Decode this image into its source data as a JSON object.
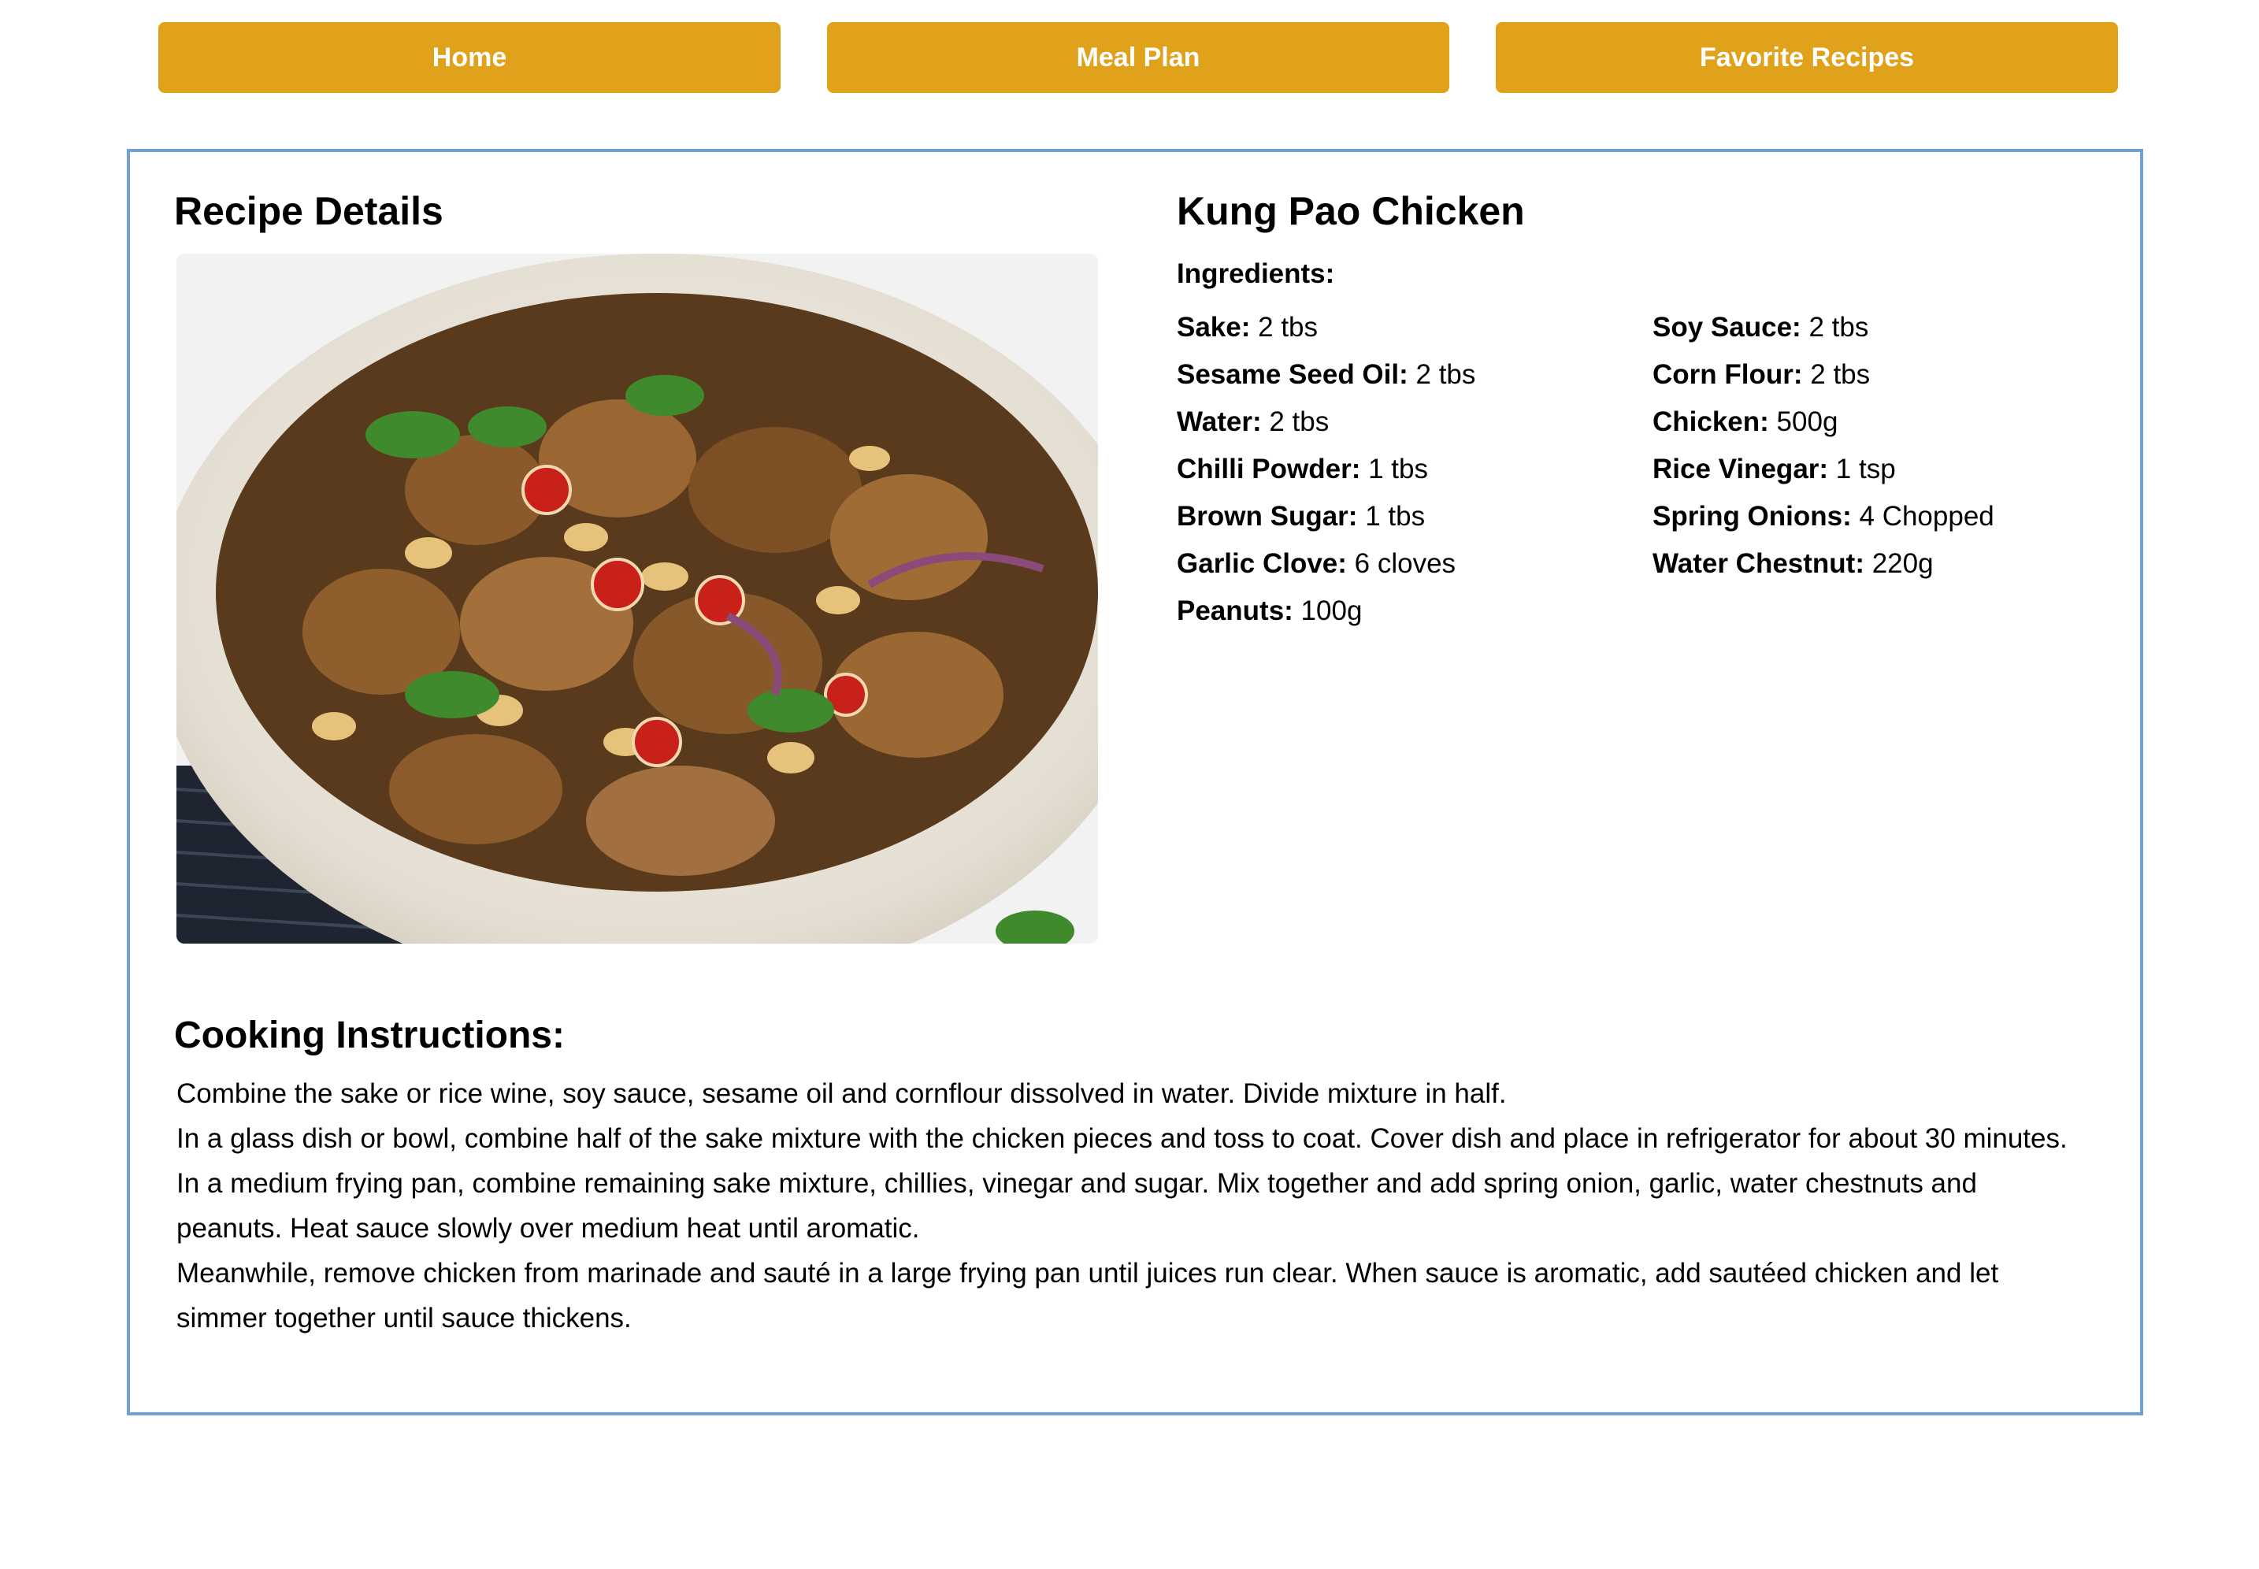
{
  "nav": {
    "buttons": [
      {
        "label": "Home"
      },
      {
        "label": "Meal Plan"
      },
      {
        "label": "Favorite Recipes"
      }
    ]
  },
  "recipe": {
    "section_title": "Recipe Details",
    "name": "Kung Pao Chicken",
    "ingredients_label": "Ingredients:",
    "ingredients_col1": [
      {
        "name": "Sake:",
        "amount": "2 tbs"
      },
      {
        "name": "Sesame Seed Oil:",
        "amount": "2 tbs"
      },
      {
        "name": "Water:",
        "amount": "2 tbs"
      },
      {
        "name": "Chilli Powder:",
        "amount": "1 tbs"
      },
      {
        "name": "Brown Sugar:",
        "amount": "1 tbs"
      },
      {
        "name": "Garlic Clove:",
        "amount": "6 cloves"
      },
      {
        "name": "Peanuts:",
        "amount": "100g"
      }
    ],
    "ingredients_col2": [
      {
        "name": "Soy Sauce:",
        "amount": "2 tbs"
      },
      {
        "name": "Corn Flour:",
        "amount": "2 tbs"
      },
      {
        "name": "Chicken:",
        "amount": "500g"
      },
      {
        "name": "Rice Vinegar:",
        "amount": "1 tsp"
      },
      {
        "name": "Spring Onions:",
        "amount": "4 Chopped"
      },
      {
        "name": "Water Chestnut:",
        "amount": "220g"
      }
    ],
    "instructions_title": "Cooking Instructions:",
    "instructions": [
      "Combine the sake or rice wine, soy sauce, sesame oil and cornflour dissolved in water. Divide mixture in half.",
      "In a glass dish or bowl, combine half of the sake mixture with the chicken pieces and toss to coat. Cover dish and place in refrigerator for about 30 minutes.",
      "In a medium frying pan, combine remaining sake mixture, chillies, vinegar and sugar. Mix together and add spring onion, garlic, water chestnuts and peanuts. Heat sauce slowly over medium heat until aromatic.",
      "Meanwhile, remove chicken from marinade and sauté in a large frying pan until juices run clear. When sauce is aromatic, add sautéed chicken and let simmer together until sauce thickens."
    ]
  },
  "colors": {
    "nav_button": "#e0a21b",
    "card_border": "#6fa0d8"
  }
}
